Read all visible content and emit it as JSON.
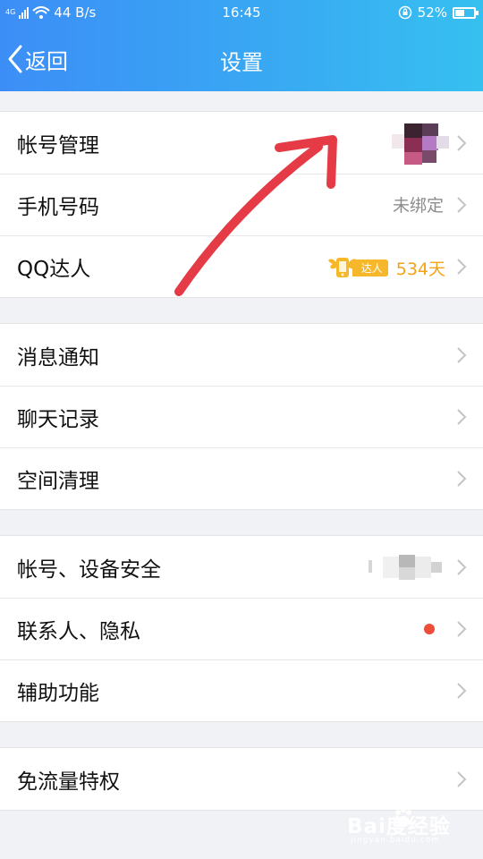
{
  "status_bar": {
    "network": "4G",
    "speed": "44 B/s",
    "time": "16:45",
    "battery_percent_text": "52%",
    "battery_level": 0.52
  },
  "header": {
    "back_label": "返回",
    "title": "设置"
  },
  "groups": [
    {
      "rows": [
        {
          "label": "帐号管理"
        },
        {
          "label": "手机号码",
          "value": "未绑定"
        },
        {
          "label": "QQ达人",
          "badge": "达人",
          "days": "534天"
        }
      ]
    },
    {
      "rows": [
        {
          "label": "消息通知"
        },
        {
          "label": "聊天记录"
        },
        {
          "label": "空间清理"
        }
      ]
    },
    {
      "rows": [
        {
          "label": "帐号、设备安全"
        },
        {
          "label": "联系人、隐私"
        },
        {
          "label": "辅助功能"
        }
      ]
    },
    {
      "rows": [
        {
          "label": "免流量特权"
        }
      ]
    }
  ],
  "colors": {
    "header_start": "#3c8ef6",
    "header_end": "#36c0f0",
    "badge": "#f6b82a",
    "days_text": "#f3a31a",
    "red_dot": "#ee4d3a",
    "annotation_arrow": "#e53b46"
  },
  "watermark": {
    "main": "Bai度经验",
    "sub": "jingyan.baidu.com"
  }
}
